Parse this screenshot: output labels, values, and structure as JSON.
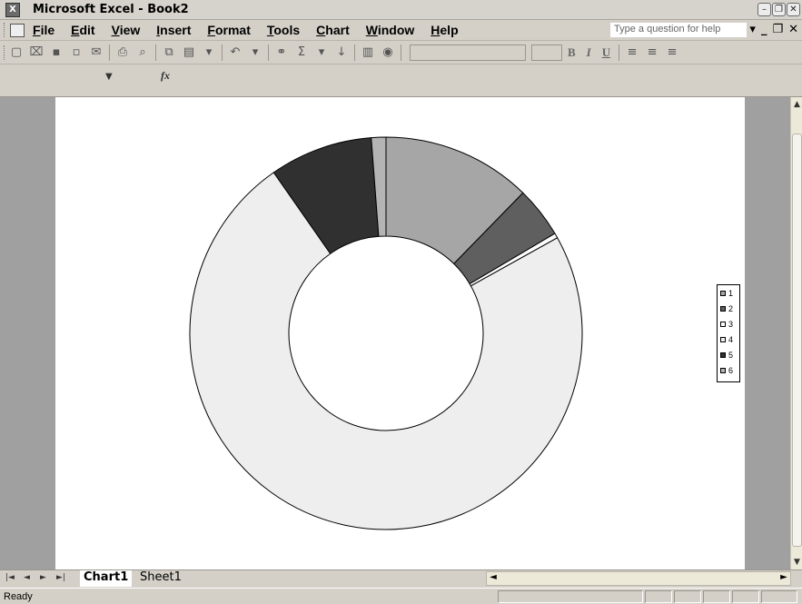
{
  "window": {
    "title": "Microsoft Excel - Book2"
  },
  "menu": {
    "items": [
      "File",
      "Edit",
      "View",
      "Insert",
      "Format",
      "Tools",
      "Chart",
      "Window",
      "Help"
    ],
    "help_placeholder": "Type a question for help"
  },
  "sheets": {
    "tabs": [
      "Chart1",
      "Sheet1"
    ],
    "active": "Chart1"
  },
  "status": {
    "text": "Ready"
  },
  "chart_data": {
    "type": "doughnut",
    "legend_position": "right",
    "categories": [
      "1",
      "2",
      "3",
      "4",
      "5",
      "6"
    ],
    "values": [
      12.3,
      4.2,
      0.4,
      73.4,
      8.5,
      1.2
    ],
    "colors": [
      "#a6a6a6",
      "#5f5f5f",
      "#ffffff",
      "#eeeeee",
      "#303030",
      "#b4b4b4"
    ]
  }
}
